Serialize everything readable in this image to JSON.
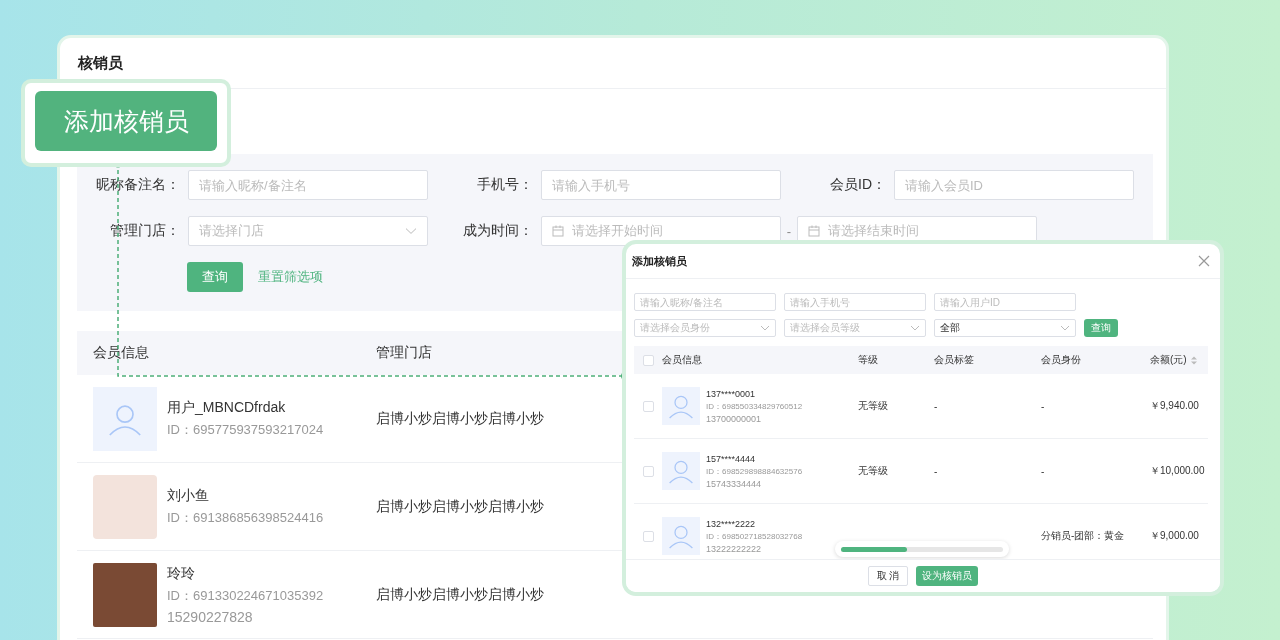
{
  "page": {
    "title": "核销员"
  },
  "callout": {
    "label": "添加核销员"
  },
  "filters": {
    "rows": [
      [
        {
          "kind": "input",
          "label": "昵称备注名：",
          "placeholder": "请输入昵称/备注名"
        },
        {
          "kind": "input",
          "label": "手机号：",
          "placeholder": "请输入手机号"
        },
        {
          "kind": "input",
          "label": "会员ID：",
          "placeholder": "请输入会员ID"
        }
      ],
      [
        {
          "kind": "select",
          "label": "管理门店：",
          "placeholder": "请选择门店"
        },
        {
          "kind": "daterange",
          "label": "成为时间：",
          "start_placeholder": "请选择开始时间",
          "separator": "-",
          "end_placeholder": "请选择结束时间"
        }
      ]
    ],
    "search": "查询",
    "reset": "重置筛选项"
  },
  "table": {
    "columns": [
      "会员信息",
      "管理门店"
    ],
    "rows": [
      {
        "avatar": {
          "kind": "default"
        },
        "name": "用户_MBNCDfrdak",
        "id": "ID：695775937593217024",
        "store": "启博小炒启博小炒启博小炒"
      },
      {
        "avatar": {
          "kind": "illustration"
        },
        "name": "刘小鱼",
        "id": "ID：691386856398524416",
        "store": "启博小炒启博小炒启博小炒"
      },
      {
        "avatar": {
          "kind": "photo"
        },
        "name": "玲玲",
        "id": "ID：691330224671035392",
        "phone": "15290227828",
        "store": "启博小炒启博小炒启博小炒"
      }
    ]
  },
  "dialog": {
    "title": "添加核销员",
    "filters": [
      {
        "kind": "input",
        "placeholder": "请输入昵称/备注名"
      },
      {
        "kind": "input",
        "placeholder": "请输入手机号"
      },
      {
        "kind": "input",
        "placeholder": "请输入用户ID"
      },
      {
        "kind": "select",
        "placeholder": "请选择会员身份"
      },
      {
        "kind": "select",
        "placeholder": "请选择会员等级"
      },
      {
        "kind": "select",
        "value": "全部"
      }
    ],
    "search": "查询",
    "header_checked": false,
    "columns": [
      {
        "label": "会员信息",
        "sortable": false
      },
      {
        "label": "等级",
        "sortable": false
      },
      {
        "label": "会员标签",
        "sortable": false
      },
      {
        "label": "会员身份",
        "sortable": false
      },
      {
        "label": "余额(元)",
        "sortable": true
      }
    ],
    "rows": [
      {
        "checked": false,
        "masked": "137****0001",
        "id": "ID：698550334829760512",
        "phone": "13700000001",
        "level_name": "无等级",
        "tag": "-",
        "identity": "-",
        "balance": "￥9,940.00"
      },
      {
        "checked": false,
        "masked": "157****4444",
        "id": "ID：698529898884632576",
        "phone": "15743334444",
        "level_name": "无等级",
        "tag": "-",
        "identity": "-",
        "balance": "￥10,000.00"
      },
      {
        "checked": false,
        "masked": "132****2222",
        "id": "ID：698502718528032768",
        "phone": "13222222222",
        "identity": "分销员-团部：黄金",
        "balance": "￥9,000.00"
      }
    ],
    "progress": {
      "level": 0.41
    },
    "buttons": [
      {
        "kind": "default",
        "label": "取 消"
      },
      {
        "kind": "primary",
        "label": "设为核销员"
      }
    ]
  }
}
